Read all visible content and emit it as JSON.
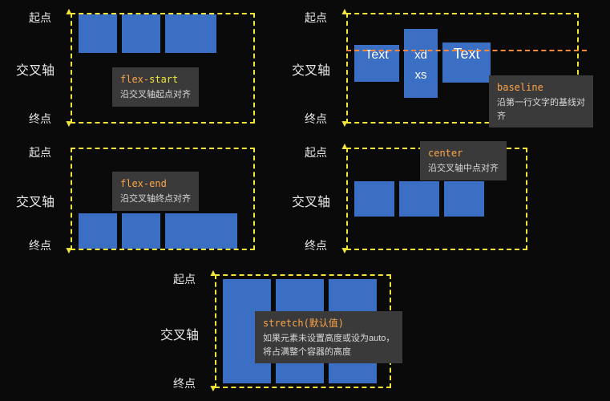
{
  "labels": {
    "start": "起点",
    "end": "终点",
    "cross_axis": "交叉轴"
  },
  "panels": {
    "flex_start": {
      "title_prefix": "flex-",
      "title_hl": "start",
      "desc": "沿交叉轴起点对齐"
    },
    "flex_end": {
      "title": "flex-end",
      "desc": "沿交叉轴终点对齐"
    },
    "center": {
      "title": "center",
      "desc": "沿交叉轴中点对齐"
    },
    "baseline": {
      "title": "baseline",
      "desc": "沿第一行文字的基线对齐",
      "blocks": {
        "a": "Text",
        "b1": "xd",
        "b2": "xs",
        "c": "Text"
      }
    },
    "stretch": {
      "title": "stretch(默认值)",
      "desc1": "如果元素未设置高度或设为auto，",
      "desc2": "将占满整个容器的高度"
    }
  }
}
